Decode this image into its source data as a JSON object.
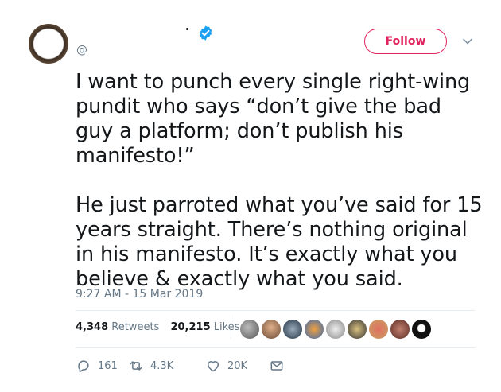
{
  "author": {
    "name": "",
    "handle": "@"
  },
  "follow_button": {
    "label": "Follow"
  },
  "tweet": {
    "paragraphs": [
      "I want to punch every single right-wing pundit who says “don’t give the bad guy a platform; don’t publish his manifesto!”",
      "He just parroted what you’ve said for 15 years straight. There’s nothing original in his manifesto. It’s exactly what you believe & exactly what you said."
    ],
    "timestamp": "9:27 AM - 15 Mar 2019"
  },
  "stats": {
    "retweets_count": "4,348",
    "retweets_label": "Retweets",
    "likes_count": "20,215",
    "likes_label": "Likes"
  },
  "actions": {
    "replies": "161",
    "retweets": "4.3K",
    "likes": "20K"
  },
  "colors": {
    "follow": "#e0245e",
    "verified": "#1da1f2",
    "muted": "#657786"
  }
}
